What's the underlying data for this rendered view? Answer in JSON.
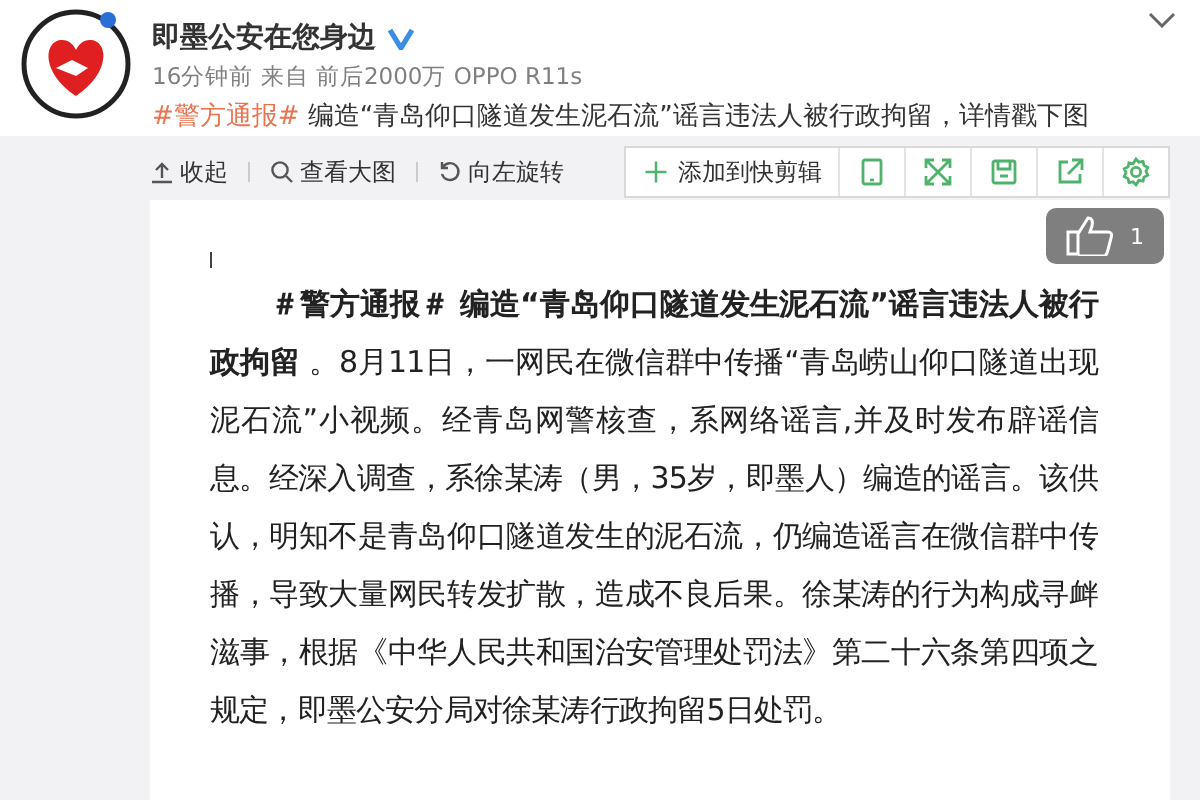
{
  "post": {
    "author": "即墨公安在您身边",
    "verified": true,
    "meta": "16分钟前 来自 前后2000万 OPPO R11s",
    "topic": "#警方通报#",
    "text": " 编造“青岛仰口隧道发生泥石流”谣言违法人被行政拘留，详情戳下图"
  },
  "toolbar": {
    "links": [
      "收起",
      "查看大图",
      "向左旋转"
    ],
    "clip_button": "添加到快剪辑",
    "likes": "1"
  },
  "document": {
    "paragraph": "**＃警方通报＃ 编造“青岛仰口隧道发生泥石流”谣言违法人被行政拘留** 。8月11日，一网民在微信群中传播“青岛崂山仰口隧道出现泥石流”小视频。经青岛网警核查，系网络谣言,并及时发布辟谣信息。经深入调查，系徐某涛（男，35岁，即墨人）编造的谣言。该供认，明知不是青岛仰口隧道发生的泥石流，仍编造谣言在微信群中传播，导致大量网民转发扩散，造成不良后果。徐某涛的行为构成寻衅滋事，根据《中华人民共和国治安管理处罚法》第二十六条第四项之规定，即墨公安分局对徐某涛行政拘留5日处罚。"
  }
}
